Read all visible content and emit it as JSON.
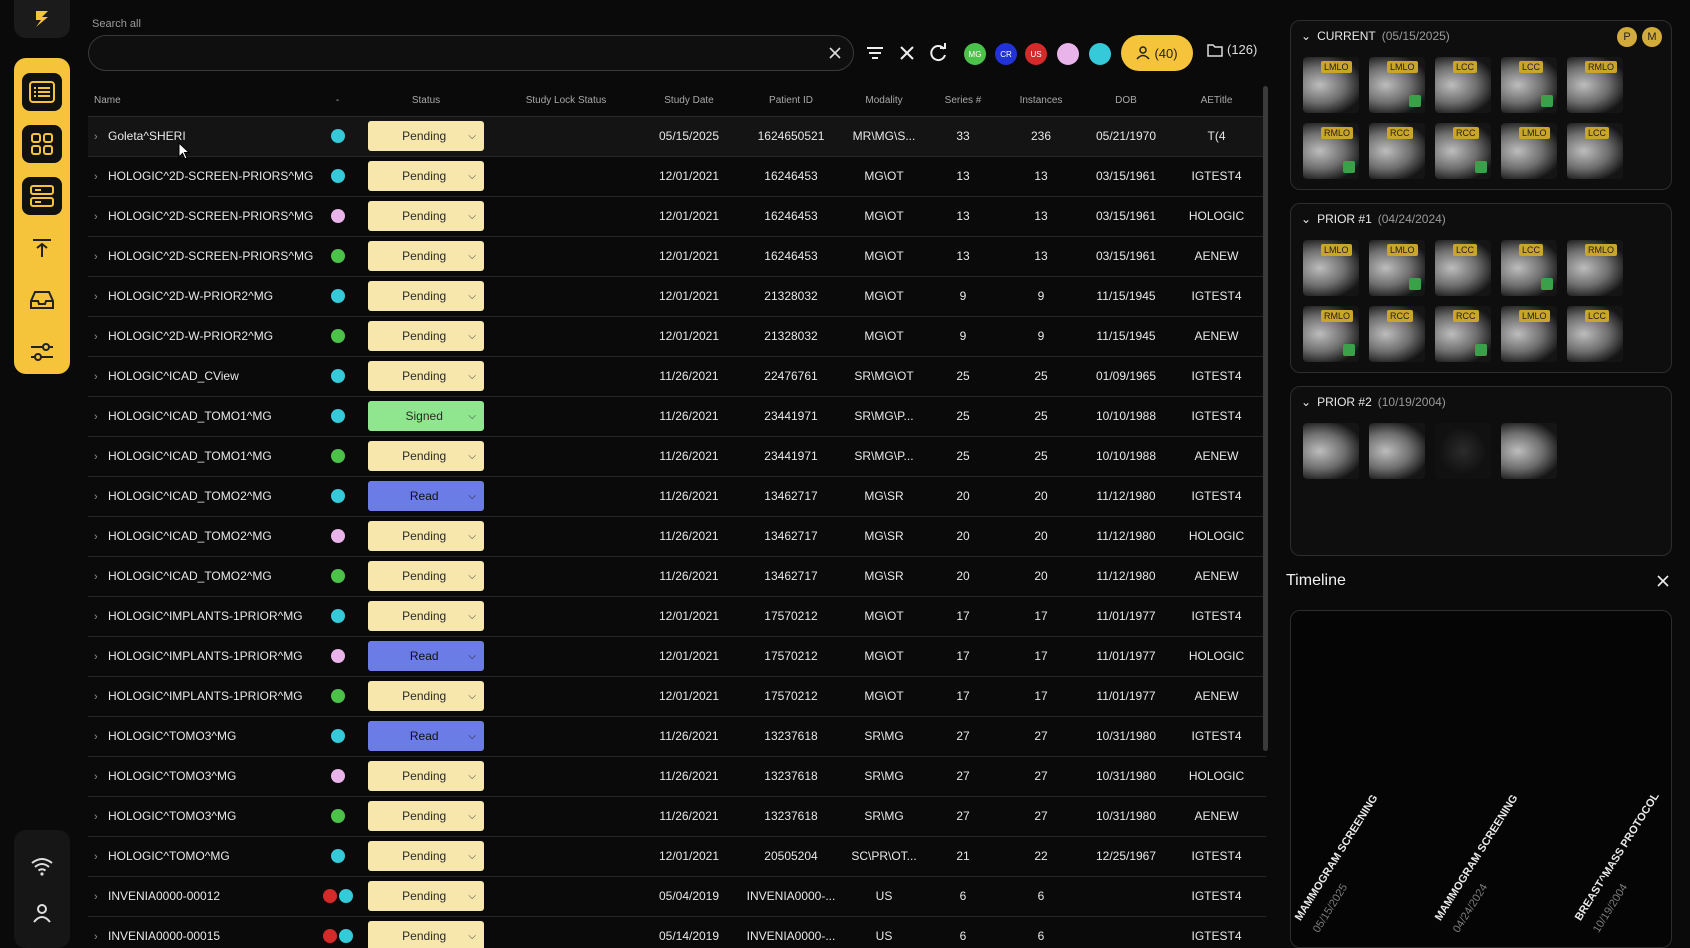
{
  "search": {
    "label": "Search all",
    "placeholder": ""
  },
  "toolbar": {
    "users_count": "(40)",
    "folder_count": "(126)",
    "modality_chips": [
      {
        "label": "MG",
        "color": "#4cc24a"
      },
      {
        "label": "CR",
        "color": "#2233d6"
      },
      {
        "label": "US",
        "color": "#d32a2a"
      },
      {
        "label": "",
        "color": "#e9b4ea"
      },
      {
        "label": "",
        "color": "#36c9d9"
      }
    ]
  },
  "columns": [
    "Name",
    "-",
    "Status",
    "Study Lock Status",
    "Study Date",
    "Patient ID",
    "Modality",
    "Series #",
    "Instances",
    "DOB",
    "AETitle"
  ],
  "rows": [
    {
      "name": "Goleta^SHERI",
      "dots": [
        "#36c9d9"
      ],
      "status": "Pending",
      "type": "pending",
      "date": "05/15/2025",
      "pid": "1624650521",
      "mod": "MR\\MG\\S...",
      "series": "33",
      "inst": "236",
      "dob": "05/21/1970",
      "ae": "T(4"
    },
    {
      "name": "HOLOGIC^2D-SCREEN-PRIORS^MG",
      "dots": [
        "#36c9d9"
      ],
      "status": "Pending",
      "type": "pending",
      "date": "12/01/2021",
      "pid": "16246453",
      "mod": "MG\\OT",
      "series": "13",
      "inst": "13",
      "dob": "03/15/1961",
      "ae": "IGTEST4"
    },
    {
      "name": "HOLOGIC^2D-SCREEN-PRIORS^MG",
      "dots": [
        "#e9b4ea"
      ],
      "status": "Pending",
      "type": "pending",
      "date": "12/01/2021",
      "pid": "16246453",
      "mod": "MG\\OT",
      "series": "13",
      "inst": "13",
      "dob": "03/15/1961",
      "ae": "HOLOGIC"
    },
    {
      "name": "HOLOGIC^2D-SCREEN-PRIORS^MG",
      "dots": [
        "#4cc24a"
      ],
      "status": "Pending",
      "type": "pending",
      "date": "12/01/2021",
      "pid": "16246453",
      "mod": "MG\\OT",
      "series": "13",
      "inst": "13",
      "dob": "03/15/1961",
      "ae": "AENEW"
    },
    {
      "name": "HOLOGIC^2D-W-PRIOR2^MG",
      "dots": [
        "#36c9d9"
      ],
      "status": "Pending",
      "type": "pending",
      "date": "12/01/2021",
      "pid": "21328032",
      "mod": "MG\\OT",
      "series": "9",
      "inst": "9",
      "dob": "11/15/1945",
      "ae": "IGTEST4"
    },
    {
      "name": "HOLOGIC^2D-W-PRIOR2^MG",
      "dots": [
        "#4cc24a"
      ],
      "status": "Pending",
      "type": "pending",
      "date": "12/01/2021",
      "pid": "21328032",
      "mod": "MG\\OT",
      "series": "9",
      "inst": "9",
      "dob": "11/15/1945",
      "ae": "AENEW"
    },
    {
      "name": "HOLOGIC^ICAD_CView",
      "dots": [
        "#36c9d9"
      ],
      "status": "Pending",
      "type": "pending",
      "date": "11/26/2021",
      "pid": "22476761",
      "mod": "SR\\MG\\OT",
      "series": "25",
      "inst": "25",
      "dob": "01/09/1965",
      "ae": "IGTEST4"
    },
    {
      "name": "HOLOGIC^ICAD_TOMO1^MG",
      "dots": [
        "#36c9d9"
      ],
      "status": "Signed",
      "type": "signed",
      "date": "11/26/2021",
      "pid": "23441971",
      "mod": "SR\\MG\\P...",
      "series": "25",
      "inst": "25",
      "dob": "10/10/1988",
      "ae": "IGTEST4"
    },
    {
      "name": "HOLOGIC^ICAD_TOMO1^MG",
      "dots": [
        "#4cc24a"
      ],
      "status": "Pending",
      "type": "pending",
      "date": "11/26/2021",
      "pid": "23441971",
      "mod": "SR\\MG\\P...",
      "series": "25",
      "inst": "25",
      "dob": "10/10/1988",
      "ae": "AENEW"
    },
    {
      "name": "HOLOGIC^ICAD_TOMO2^MG",
      "dots": [
        "#36c9d9"
      ],
      "status": "Read",
      "type": "read",
      "date": "11/26/2021",
      "pid": "13462717",
      "mod": "MG\\SR",
      "series": "20",
      "inst": "20",
      "dob": "11/12/1980",
      "ae": "IGTEST4"
    },
    {
      "name": "HOLOGIC^ICAD_TOMO2^MG",
      "dots": [
        "#e9b4ea"
      ],
      "status": "Pending",
      "type": "pending",
      "date": "11/26/2021",
      "pid": "13462717",
      "mod": "MG\\SR",
      "series": "20",
      "inst": "20",
      "dob": "11/12/1980",
      "ae": "HOLOGIC"
    },
    {
      "name": "HOLOGIC^ICAD_TOMO2^MG",
      "dots": [
        "#4cc24a"
      ],
      "status": "Pending",
      "type": "pending",
      "date": "11/26/2021",
      "pid": "13462717",
      "mod": "MG\\SR",
      "series": "20",
      "inst": "20",
      "dob": "11/12/1980",
      "ae": "AENEW"
    },
    {
      "name": "HOLOGIC^IMPLANTS-1PRIOR^MG",
      "dots": [
        "#36c9d9"
      ],
      "status": "Pending",
      "type": "pending",
      "date": "12/01/2021",
      "pid": "17570212",
      "mod": "MG\\OT",
      "series": "17",
      "inst": "17",
      "dob": "11/01/1977",
      "ae": "IGTEST4"
    },
    {
      "name": "HOLOGIC^IMPLANTS-1PRIOR^MG",
      "dots": [
        "#e9b4ea"
      ],
      "status": "Read",
      "type": "read",
      "date": "12/01/2021",
      "pid": "17570212",
      "mod": "MG\\OT",
      "series": "17",
      "inst": "17",
      "dob": "11/01/1977",
      "ae": "HOLOGIC"
    },
    {
      "name": "HOLOGIC^IMPLANTS-1PRIOR^MG",
      "dots": [
        "#4cc24a"
      ],
      "status": "Pending",
      "type": "pending",
      "date": "12/01/2021",
      "pid": "17570212",
      "mod": "MG\\OT",
      "series": "17",
      "inst": "17",
      "dob": "11/01/1977",
      "ae": "AENEW"
    },
    {
      "name": "HOLOGIC^TOMO3^MG",
      "dots": [
        "#36c9d9"
      ],
      "status": "Read",
      "type": "read",
      "date": "11/26/2021",
      "pid": "13237618",
      "mod": "SR\\MG",
      "series": "27",
      "inst": "27",
      "dob": "10/31/1980",
      "ae": "IGTEST4"
    },
    {
      "name": "HOLOGIC^TOMO3^MG",
      "dots": [
        "#e9b4ea"
      ],
      "status": "Pending",
      "type": "pending",
      "date": "11/26/2021",
      "pid": "13237618",
      "mod": "SR\\MG",
      "series": "27",
      "inst": "27",
      "dob": "10/31/1980",
      "ae": "HOLOGIC"
    },
    {
      "name": "HOLOGIC^TOMO3^MG",
      "dots": [
        "#4cc24a"
      ],
      "status": "Pending",
      "type": "pending",
      "date": "11/26/2021",
      "pid": "13237618",
      "mod": "SR\\MG",
      "series": "27",
      "inst": "27",
      "dob": "10/31/1980",
      "ae": "AENEW"
    },
    {
      "name": "HOLOGIC^TOMO^MG",
      "dots": [
        "#36c9d9"
      ],
      "status": "Pending",
      "type": "pending",
      "date": "12/01/2021",
      "pid": "20505204",
      "mod": "SC\\PR\\OT...",
      "series": "21",
      "inst": "22",
      "dob": "12/25/1967",
      "ae": "IGTEST4"
    },
    {
      "name": "INVENIA0000-00012",
      "dots": [
        "#d32a2a",
        "#36c9d9"
      ],
      "status": "Pending",
      "type": "pending",
      "date": "05/04/2019",
      "pid": "INVENIA0000-...",
      "mod": "US",
      "series": "6",
      "inst": "6",
      "dob": "",
      "ae": "IGTEST4"
    },
    {
      "name": "INVENIA0000-00015",
      "dots": [
        "#d32a2a",
        "#36c9d9"
      ],
      "status": "Pending",
      "type": "pending",
      "date": "05/14/2019",
      "pid": "INVENIA0000-...",
      "mod": "US",
      "series": "6",
      "inst": "6",
      "dob": "",
      "ae": "IGTEST4"
    }
  ],
  "studies": {
    "current": {
      "label": "CURRENT",
      "date": "(05/15/2025)",
      "avatars": [
        "P",
        "M"
      ],
      "tags": [
        "LMLO",
        "LMLO",
        "LCC",
        "LCC",
        "RMLO",
        "RMLO",
        "RCC",
        "RCC",
        "LMLO",
        "LCC"
      ]
    },
    "prior1": {
      "label": "PRIOR #1",
      "date": "(04/24/2024)",
      "tags": [
        "LMLO",
        "LMLO",
        "LCC",
        "LCC",
        "RMLO",
        "RMLO",
        "RCC",
        "RCC",
        "LMLO",
        "LCC"
      ]
    },
    "prior2": {
      "label": "PRIOR #2",
      "date": "(10/19/2004)"
    }
  },
  "timeline": {
    "title": "Timeline",
    "entries": [
      {
        "label": "MAMMOGRAM SCREENING",
        "date": "05/15/2025"
      },
      {
        "label": "MAMMOGRAM SCREENING",
        "date": "04/24/2024"
      },
      {
        "label": "BREAST^MASS PROTOCOL",
        "date": "10/19/2004"
      }
    ]
  }
}
